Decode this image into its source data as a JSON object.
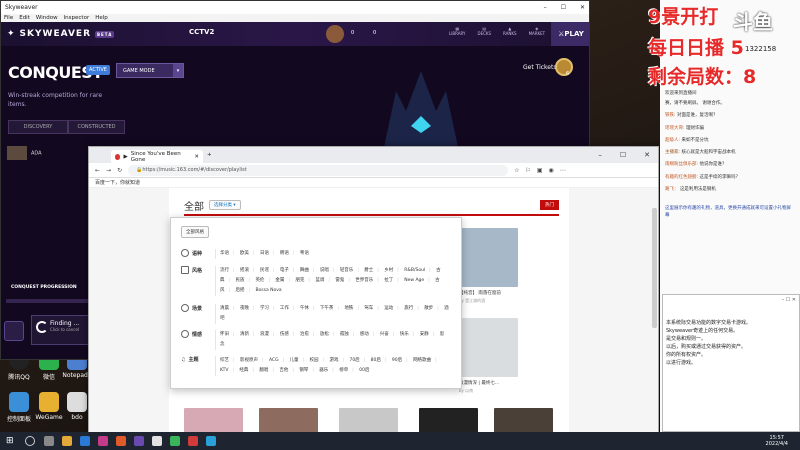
{
  "skyweaver": {
    "window_title": "Skyweaver",
    "menu": [
      "File",
      "Edit",
      "Window",
      "Inspector",
      "Help"
    ],
    "logo": "SKYWEAVER",
    "beta": "BETA",
    "channel": "CCTV2",
    "currency_a": "0",
    "currency_b": "0",
    "nav": [
      "LIBRARY",
      "DECKS",
      "RANKS",
      "MARKET"
    ],
    "play": "PLAY",
    "mode_title": "CONQUEST",
    "active": "ACTIVE",
    "game_mode": "GAME MODE",
    "subtitle": "Win-streak competition for rare items.",
    "tab_discovery": "DISCOVERY",
    "tab_constructed": "CONSTRUCTED",
    "get_tickets": "Get Tickets",
    "ticket_count": "6",
    "player_name": "ADA",
    "progress_label": "CONQUEST PROGRESSION",
    "finding": "Finding ...",
    "finding_sub": "Click to cancel"
  },
  "browser": {
    "tab_title": "Since You've Been Gone",
    "url": "https://music.163.com/#/discover/playlist",
    "bookmark": "百度一下，你就知道",
    "all_label": "全部",
    "select_cat": "选择分类",
    "hot": "热门",
    "all_styles": "全部风格",
    "categories": [
      {
        "name": "语种",
        "tags": [
          "华语",
          "欧美",
          "日语",
          "韩语",
          "粤语"
        ]
      },
      {
        "name": "风格",
        "tags": [
          "流行",
          "摇滚",
          "民谣",
          "电子",
          "舞曲",
          "说唱",
          "轻音乐",
          "爵士",
          "乡村",
          "R&B/Soul",
          "古典",
          "民族",
          "英伦",
          "金属",
          "朋克",
          "蓝调",
          "雷鬼",
          "世界音乐",
          "拉丁",
          "New Age",
          "古风",
          "后摇",
          "Bossa Nova"
        ]
      },
      {
        "name": "场景",
        "tags": [
          "清晨",
          "夜晚",
          "学习",
          "工作",
          "午休",
          "下午茶",
          "地铁",
          "驾车",
          "运动",
          "旅行",
          "散步",
          "酒吧"
        ]
      },
      {
        "name": "情感",
        "tags": [
          "怀旧",
          "清新",
          "浪漫",
          "伤感",
          "治愈",
          "放松",
          "孤独",
          "感动",
          "兴奋",
          "快乐",
          "安静",
          "思念"
        ]
      },
      {
        "name": "主题",
        "tags": [
          "综艺",
          "影视原声",
          "ACG",
          "儿童",
          "校园",
          "游戏",
          "70后",
          "80后",
          "90后",
          "网络歌曲",
          "KTV",
          "经典",
          "翻唱",
          "吉他",
          "钢琴",
          "器乐",
          "榜单",
          "00后"
        ]
      }
    ],
    "thumb_captions": [
      {
        "title": "【纯音】 雨落在窗前",
        "by": "by 是江湖的酒"
      },
      {
        "title": "浪漫情深 | 最终七...",
        "by": "by 以南"
      }
    ]
  },
  "chat": {
    "big_lines": [
      "9景开打",
      "每日日播 5",
      "剩余局数：8"
    ],
    "logo": "斗鱼",
    "viewers": "1322158",
    "messages": [
      {
        "user": "",
        "text": "欢迎来到直播间"
      },
      {
        "user": "",
        "text": "赛，请不要刷屏。 谢谢合作。"
      },
      {
        "user": "铁铁:",
        "text": "对面是谁，复活啊？"
      },
      {
        "user": "瑶瑶大哥:",
        "text": "理财诈骗"
      },
      {
        "user": "超级人:",
        "text": "来如不是分坑"
      },
      {
        "user": "主播家:",
        "text": "核心就是大船和宇宙战本机"
      },
      {
        "user": "雨桐粉丝俱乐部:",
        "text": "他说你是谁？"
      },
      {
        "user": "有趣的红色翅膀:",
        "text": "这是手续的李嘛吗？"
      },
      {
        "user": "路飞：",
        "text": "这是利用法是钢机"
      }
    ],
    "notice": "这里展示你有趣的礼物，道具，更换开通成就来可设置小礼物屏幕",
    "mini_lines": [
      "本系统际交易功能的数字交易卡游戏。",
      "Skyweaver奇迹上的任何交易。",
      "是交易和规则一。",
      "以后，购买或通过交易获得的资产。",
      "你的所有权资产。",
      "以进行游戏。"
    ]
  },
  "taskbar": {
    "time": "15:57",
    "date": "2022/4/4"
  },
  "desktop_icons": [
    "腾讯QQ",
    "微信",
    "Notepad3",
    "控制面板",
    "WeGame",
    "bdo",
    "此电脑"
  ]
}
